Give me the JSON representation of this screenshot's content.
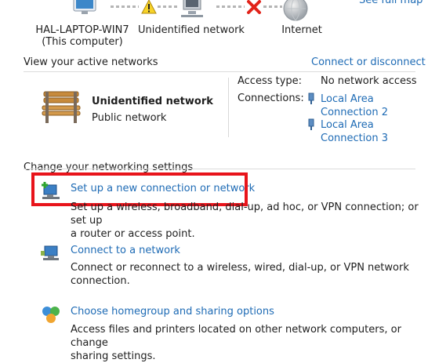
{
  "top_link": "See full map",
  "network_map": {
    "computer_name": "HAL-LAPTOP-WIN7",
    "computer_sub": "(This computer)",
    "network_label": "Unidentified network",
    "internet_label": "Internet"
  },
  "active": {
    "heading": "View your active networks",
    "connect_link": "Connect or disconnect",
    "network_name": "Unidentified network",
    "network_type": "Public network",
    "access_type_label": "Access type:",
    "access_type_value": "No network access",
    "connections_label": "Connections:",
    "connections": [
      {
        "line1": "Local Area",
        "line2": "Connection 2"
      },
      {
        "line1": "Local Area",
        "line2": "Connection 3"
      }
    ]
  },
  "settings": {
    "heading": "Change your networking settings",
    "tasks": [
      {
        "title": "Set up a new connection or network",
        "desc1": "Set up a wireless, broadband, dial-up, ad hoc, or VPN connection; or set up",
        "desc2": "a router or access point."
      },
      {
        "title": "Connect to a network",
        "desc1": "Connect or reconnect to a wireless, wired, dial-up, or VPN network",
        "desc2": "connection."
      },
      {
        "title": "Choose homegroup and sharing options",
        "desc1": "Access files and printers located on other network computers, or change",
        "desc2": "sharing settings."
      }
    ]
  },
  "highlight_color": "#e8141b",
  "link_color": "#1e6bb5"
}
